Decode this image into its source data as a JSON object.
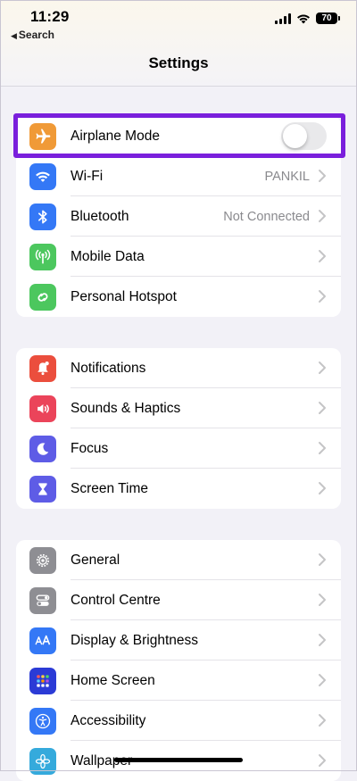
{
  "status": {
    "time": "11:29",
    "back_label": "Search",
    "battery": "70"
  },
  "header": {
    "title": "Settings"
  },
  "groups": [
    {
      "rows": [
        {
          "label": "Airplane Mode",
          "icon": "airplane-icon",
          "color": "#f09a37",
          "toggle": false
        },
        {
          "label": "Wi-Fi",
          "value": "PANKIL",
          "icon": "wifi-icon",
          "color": "#3478f6"
        },
        {
          "label": "Bluetooth",
          "value": "Not Connected",
          "icon": "bluetooth-icon",
          "color": "#3478f6"
        },
        {
          "label": "Mobile Data",
          "icon": "antenna-icon",
          "color": "#4cc75e"
        },
        {
          "label": "Personal Hotspot",
          "icon": "hotspot-icon",
          "color": "#4cc75e"
        }
      ]
    },
    {
      "rows": [
        {
          "label": "Notifications",
          "icon": "bell-icon",
          "color": "#eb4e3d"
        },
        {
          "label": "Sounds & Haptics",
          "icon": "speaker-icon",
          "color": "#eb445a"
        },
        {
          "label": "Focus",
          "icon": "moon-icon",
          "color": "#5e5ce6"
        },
        {
          "label": "Screen Time",
          "icon": "hourglass-icon",
          "color": "#5e5ce6"
        }
      ]
    },
    {
      "rows": [
        {
          "label": "General",
          "icon": "gear-icon",
          "color": "#8e8e93"
        },
        {
          "label": "Control Centre",
          "icon": "switches-icon",
          "color": "#8e8e93"
        },
        {
          "label": "Display & Brightness",
          "icon": "text-size-icon",
          "color": "#3478f6"
        },
        {
          "label": "Home Screen",
          "icon": "app-grid-icon",
          "color": "#2b3bd6"
        },
        {
          "label": "Accessibility",
          "icon": "accessibility-icon",
          "color": "#3478f6"
        },
        {
          "label": "Wallpaper",
          "icon": "flower-icon",
          "color": "#35aadc"
        }
      ]
    }
  ]
}
